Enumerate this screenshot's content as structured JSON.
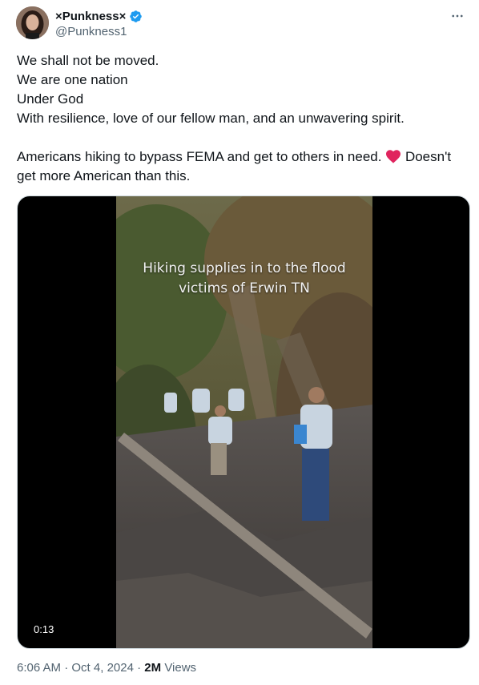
{
  "author": {
    "display_name": "×Punkness×",
    "handle": "@Punkness1",
    "verified": true
  },
  "tweet": {
    "lines": [
      "We shall not be moved.",
      "We are one nation",
      "Under God",
      "With resilience, love of our fellow man, and an unwavering spirit."
    ],
    "para2_before_emoji": "Americans hiking to bypass FEMA and get to others in need.",
    "para2_after_emoji": "Doesn't",
    "para2_line2": "get more American than this."
  },
  "media": {
    "caption_line1": "Hiking supplies in to the flood",
    "caption_line2": "victims of Erwin TN",
    "duration": "0:13"
  },
  "meta": {
    "time": "6:06 AM",
    "date": "Oct 4, 2024",
    "views_count": "2M",
    "views_label": "Views"
  },
  "colors": {
    "verified": "#1d9bf0",
    "secondary_text": "#536471",
    "primary_text": "#0f1419",
    "heart": "#e0245e"
  },
  "icons": [
    "verified-badge-icon",
    "more-options-icon",
    "red-heart-emoji"
  ]
}
